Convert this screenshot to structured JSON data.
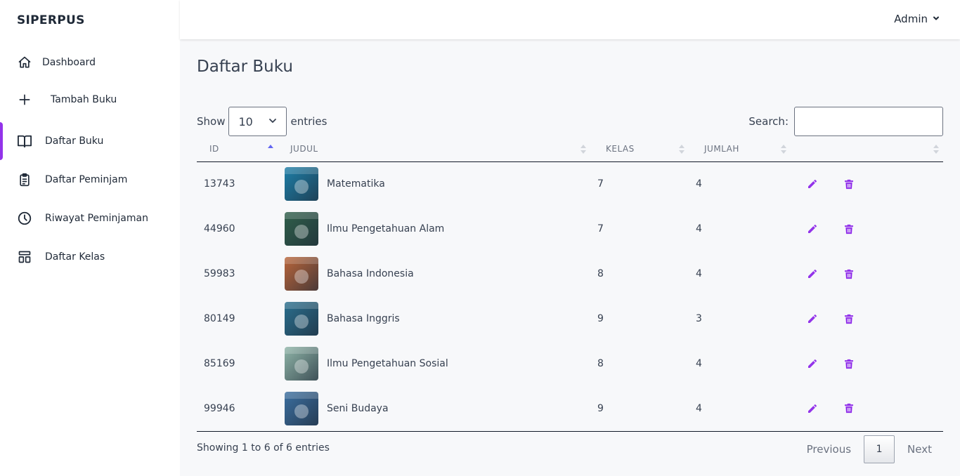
{
  "app": {
    "brand": "SIPERPUS",
    "user": "Admin",
    "accent": "#9333ea"
  },
  "sidebar": {
    "items": [
      {
        "label": "Dashboard",
        "icon": "home-icon"
      },
      {
        "label": "Tambah Buku",
        "icon": "plus-icon"
      },
      {
        "label": "Daftar Buku",
        "icon": "book-open-icon",
        "active": true
      },
      {
        "label": "Daftar Peminjam",
        "icon": "clipboard-list-icon"
      },
      {
        "label": "Riwayat Peminjaman",
        "icon": "clock-icon"
      },
      {
        "label": "Daftar Kelas",
        "icon": "template-icon"
      }
    ]
  },
  "page": {
    "title": "Daftar Buku"
  },
  "table_controls": {
    "show_label": "Show",
    "entries_value": "10",
    "entries_label": "entries",
    "search_label": "Search:",
    "search_value": ""
  },
  "table": {
    "columns": [
      "ID",
      "JUDUL",
      "KELAS",
      "JUMLAH",
      ""
    ],
    "sorted_column": "ID",
    "rows": [
      {
        "id": "13743",
        "judul": "Matematika",
        "kelas": "7",
        "jumlah": "4",
        "cover_color": "#1e7fa8"
      },
      {
        "id": "44960",
        "judul": "Ilmu Pengetahuan Alam",
        "kelas": "7",
        "jumlah": "4",
        "cover_color": "#2f5f4a"
      },
      {
        "id": "59983",
        "judul": "Bahasa Indonesia",
        "kelas": "8",
        "jumlah": "4",
        "cover_color": "#b9653a"
      },
      {
        "id": "80149",
        "judul": "Bahasa Inggris",
        "kelas": "9",
        "jumlah": "3",
        "cover_color": "#2a6f8e"
      },
      {
        "id": "85169",
        "judul": "Ilmu Pengetahuan Sosial",
        "kelas": "8",
        "jumlah": "4",
        "cover_color": "#8fb5a8"
      },
      {
        "id": "99946",
        "judul": "Seni Budaya",
        "kelas": "9",
        "jumlah": "4",
        "cover_color": "#3b6fa0"
      }
    ],
    "action_icons": [
      "pencil-icon",
      "trash-icon"
    ],
    "action_color": "#9333ea"
  },
  "footer": {
    "info": "Showing 1 to 6 of 6 entries",
    "previous": "Previous",
    "current_page": "1",
    "next": "Next"
  }
}
